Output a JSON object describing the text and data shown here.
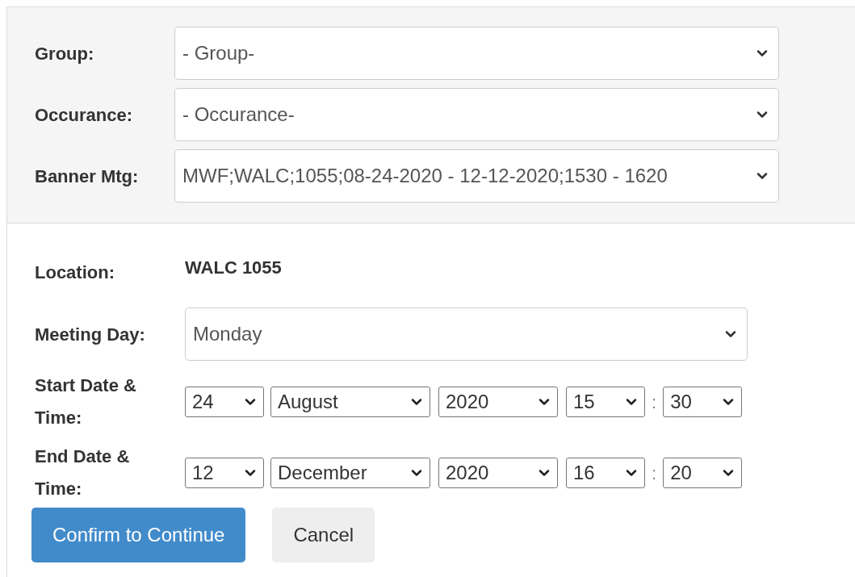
{
  "filters": [
    {
      "label": "Group:",
      "value": "- Group-"
    },
    {
      "label": "Occurance:",
      "value": "- Occurance-"
    },
    {
      "label": "Banner Mtg:",
      "value": "MWF;WALC;1055;08-24-2020 - 12-12-2020;1530 - 1620"
    }
  ],
  "location": {
    "label": "Location:",
    "value": "WALC 1055"
  },
  "meeting_day": {
    "label": "Meeting Day:",
    "value": "Monday"
  },
  "date_rows": [
    {
      "label": "Start Date & Time:",
      "day": "24",
      "month": "August",
      "year": "2020",
      "hour": "15",
      "separator": ":",
      "minute": "30"
    },
    {
      "label": "End Date & Time:",
      "day": "12",
      "month": "December",
      "year": "2020",
      "hour": "16",
      "separator": ":",
      "minute": "20"
    }
  ],
  "buttons": [
    {
      "label": "Confirm to Continue",
      "kind": "primary"
    },
    {
      "label": "Cancel",
      "kind": "default"
    }
  ]
}
